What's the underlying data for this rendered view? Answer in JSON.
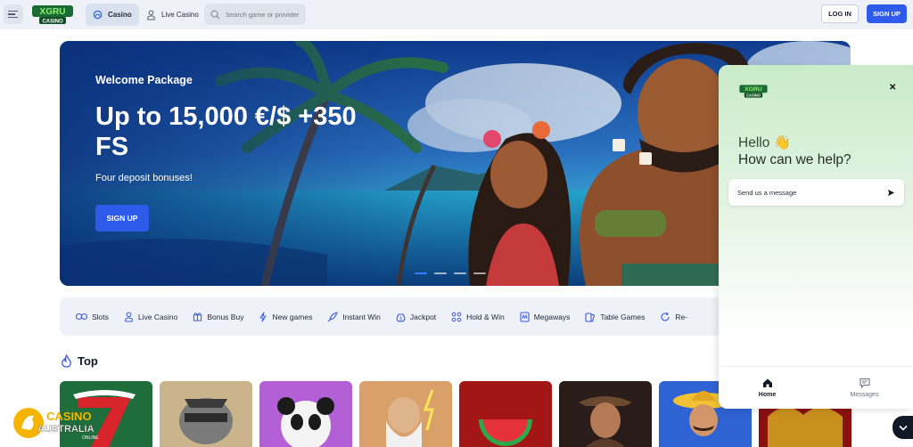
{
  "header": {
    "menu_icon": "hamburger-icon",
    "logo_text": [
      "XGRU",
      "CASINO"
    ],
    "nav": [
      {
        "label": "Casino",
        "icon": "club-icon",
        "active": true
      },
      {
        "label": "Live Casino",
        "icon": "dealer-icon",
        "active": false
      }
    ],
    "search_placeholder": "Search game or provider",
    "login_label": "LOG IN",
    "signup_label": "SIGN UP",
    "accent_color": "#2f5bea"
  },
  "hero": {
    "eyebrow": "Welcome Package",
    "title": "Up to 15,000 €/$ +350 FS",
    "subtitle": "Four deposit bonuses!",
    "cta_label": "SIGN UP",
    "slides_count": 4,
    "active_slide": 1
  },
  "categories": [
    {
      "label": "Slots",
      "icon": "slots-icon"
    },
    {
      "label": "Live Casino",
      "icon": "dealer-icon"
    },
    {
      "label": "Bonus Buy",
      "icon": "gift-icon"
    },
    {
      "label": "New games",
      "icon": "lightning-icon"
    },
    {
      "label": "Instant Win",
      "icon": "rocket-icon"
    },
    {
      "label": "Jackpot",
      "icon": "money-bag-icon"
    },
    {
      "label": "Hold & Win",
      "icon": "grid-icon"
    },
    {
      "label": "Megaways",
      "icon": "megaways-icon"
    },
    {
      "label": "Table Games",
      "icon": "cards-icon"
    },
    {
      "label": "Re-",
      "icon": "refresh-icon"
    }
  ],
  "section": {
    "title": "Top",
    "icon": "fire-icon"
  },
  "games": [
    {
      "name": "lucky-seven",
      "color": "#1f6d3a"
    },
    {
      "name": "raccoon-robber",
      "color": "#c9b48b"
    },
    {
      "name": "panda",
      "color": "#b35fd6"
    },
    {
      "name": "zeus",
      "color": "#d9a06a"
    },
    {
      "name": "watermelon",
      "color": "#a31616"
    },
    {
      "name": "wild-west",
      "color": "#2a1d19"
    },
    {
      "name": "mexican",
      "color": "#2f62d3"
    },
    {
      "name": "dragon",
      "color": "#8a1010"
    }
  ],
  "chat": {
    "logo_text": [
      "XGRU",
      "CASINO"
    ],
    "close_icon": "close-icon",
    "hello": "Hello 👋",
    "help": "How can we help?",
    "input_placeholder": "Send us a message",
    "tabs": [
      {
        "label": "Home",
        "icon": "home-icon",
        "active": true
      },
      {
        "label": "Messages",
        "icon": "message-icon",
        "active": false
      }
    ]
  },
  "watermark": {
    "line1": "CASINO",
    "line2": "AUSTRALIA",
    "line3": "ONLINE"
  },
  "fab_icon": "chevron-down-icon"
}
